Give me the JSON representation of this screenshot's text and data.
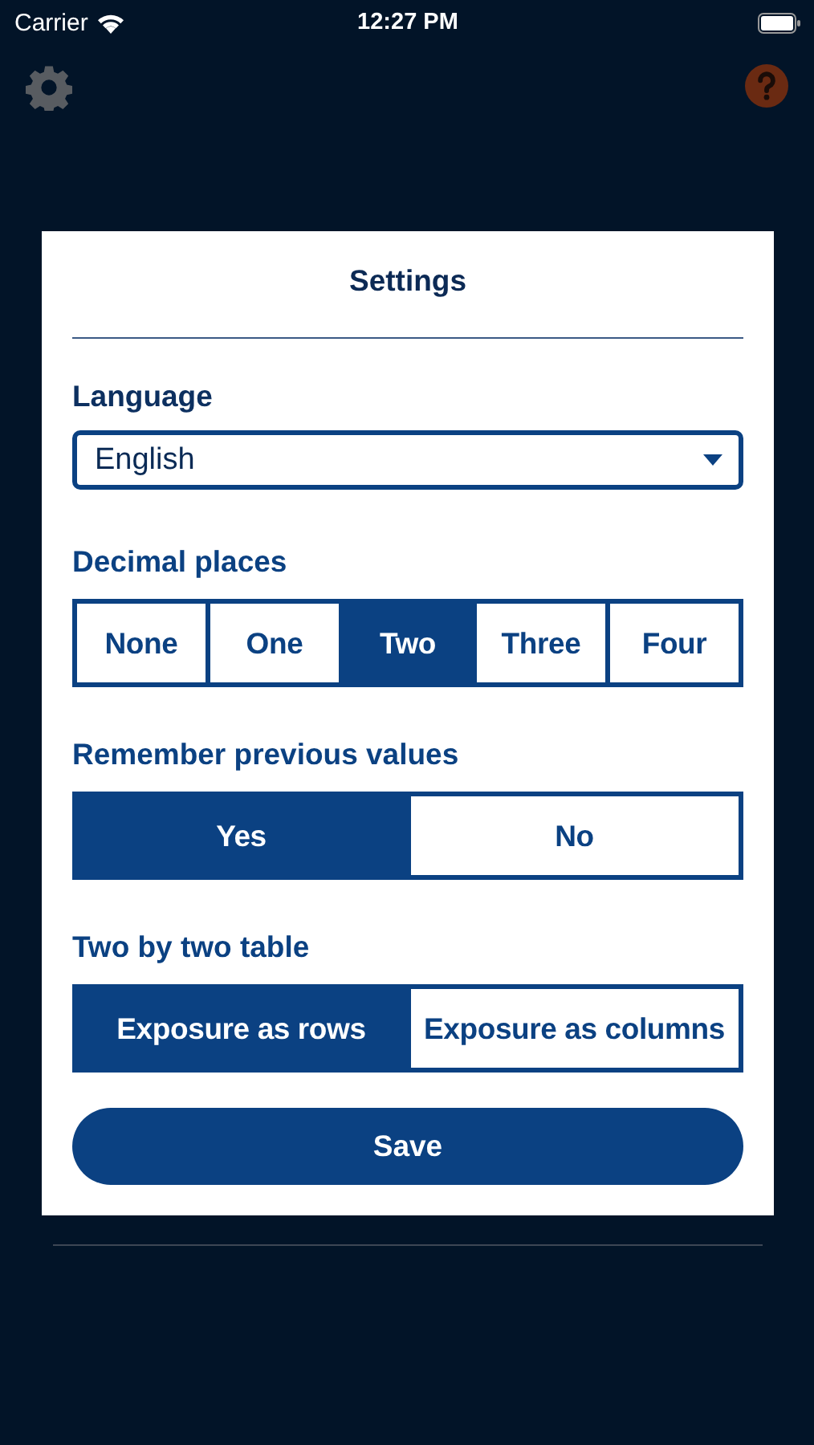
{
  "status_bar": {
    "carrier": "Carrier",
    "time": "12:27 PM"
  },
  "dialog": {
    "title": "Settings",
    "sections": [
      {
        "kind": "dropdown",
        "label": "Language",
        "value": "English"
      },
      {
        "kind": "segments",
        "label": "Decimal places",
        "options": [
          {
            "label": "None",
            "selected": false
          },
          {
            "label": "One",
            "selected": false
          },
          {
            "label": "Two",
            "selected": true
          },
          {
            "label": "Three",
            "selected": false
          },
          {
            "label": "Four",
            "selected": false
          }
        ]
      },
      {
        "kind": "segments",
        "label": "Remember previous values",
        "options": [
          {
            "label": "Yes",
            "selected": true
          },
          {
            "label": "No",
            "selected": false
          }
        ]
      },
      {
        "kind": "segments",
        "label": "Two by two table",
        "options": [
          {
            "label": "Exposure as rows",
            "selected": true
          },
          {
            "label": "Exposure as columns",
            "selected": false
          }
        ]
      }
    ],
    "save_button": "Save"
  }
}
